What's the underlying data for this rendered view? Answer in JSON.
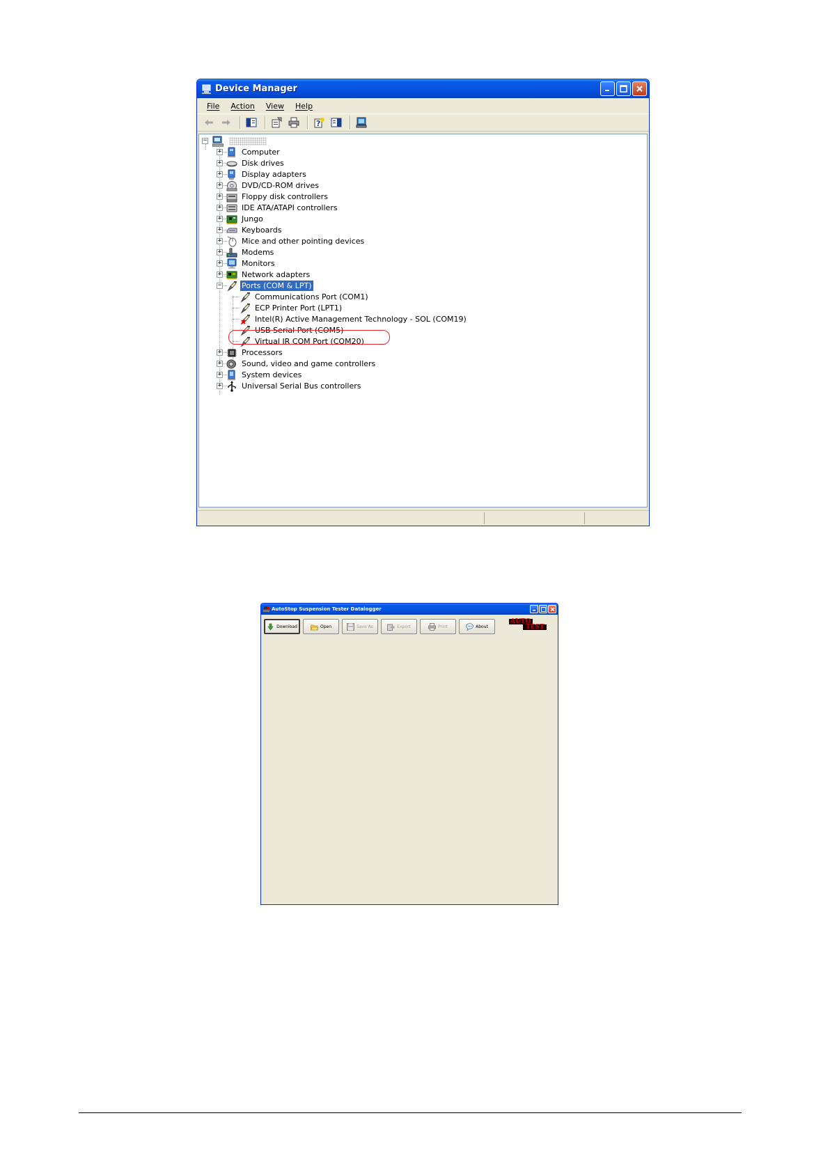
{
  "device_manager": {
    "title": "Device Manager",
    "menu": [
      "File",
      "Action",
      "View",
      "Help"
    ],
    "toolbar_icons": [
      "back-arrow-icon",
      "forward-arrow-icon",
      "show-hide-tree-icon",
      "properties-icon",
      "print-icon",
      "help-icon",
      "show-hide-console-icon",
      "scan-hardware-icon"
    ],
    "tree": {
      "root_label": "",
      "categories": [
        {
          "label": "Computer",
          "icon": "computer-icon",
          "expanded": false
        },
        {
          "label": "Disk drives",
          "icon": "disk-drive-icon",
          "expanded": false
        },
        {
          "label": "Display adapters",
          "icon": "display-adapter-icon",
          "expanded": false
        },
        {
          "label": "DVD/CD-ROM drives",
          "icon": "cd-drive-icon",
          "expanded": false
        },
        {
          "label": "Floppy disk controllers",
          "icon": "floppy-controller-icon",
          "expanded": false
        },
        {
          "label": "IDE ATA/ATAPI controllers",
          "icon": "ide-controller-icon",
          "expanded": false
        },
        {
          "label": "Jungo",
          "icon": "board-icon",
          "expanded": false
        },
        {
          "label": "Keyboards",
          "icon": "keyboard-icon",
          "expanded": false
        },
        {
          "label": "Mice and other pointing devices",
          "icon": "mouse-icon",
          "expanded": false
        },
        {
          "label": "Modems",
          "icon": "modem-icon",
          "expanded": false
        },
        {
          "label": "Monitors",
          "icon": "monitor-icon",
          "expanded": false
        },
        {
          "label": "Network adapters",
          "icon": "network-adapter-icon",
          "expanded": false
        },
        {
          "label": "Ports (COM & LPT)",
          "icon": "port-icon",
          "expanded": true,
          "selected": true,
          "children": [
            {
              "label": "Communications Port (COM1)",
              "icon": "port-icon"
            },
            {
              "label": "ECP Printer Port (LPT1)",
              "icon": "port-icon"
            },
            {
              "label": "Intel(R) Active Management Technology - SOL (COM19)",
              "icon": "port-icon"
            },
            {
              "label": "USB Serial Port (COM5)",
              "icon": "port-icon",
              "highlighted": true
            },
            {
              "label": "Virtual IR COM Port (COM20)",
              "icon": "port-icon"
            }
          ]
        },
        {
          "label": "Processors",
          "icon": "processor-icon",
          "expanded": false
        },
        {
          "label": "Sound, video and game controllers",
          "icon": "sound-icon",
          "expanded": false
        },
        {
          "label": "System devices",
          "icon": "system-device-icon",
          "expanded": false
        },
        {
          "label": "Universal Serial Bus controllers",
          "icon": "usb-icon",
          "expanded": false
        }
      ]
    }
  },
  "datalogger": {
    "title": "AutoStop Suspension Tester Datalogger",
    "buttons": [
      {
        "label": "Download",
        "icon": "download-arrow-icon",
        "enabled": true,
        "default": true
      },
      {
        "label": "Open",
        "icon": "folder-open-icon",
        "enabled": true
      },
      {
        "label": "Save As",
        "icon": "floppy-save-icon",
        "enabled": false
      },
      {
        "label": "Export",
        "icon": "export-icon",
        "enabled": false
      },
      {
        "label": "Print",
        "icon": "printer-icon",
        "enabled": false
      },
      {
        "label": "About",
        "icon": "speech-bubble-icon",
        "enabled": true
      }
    ],
    "logo": {
      "line1": "AUTO",
      "line2": "TEST"
    }
  },
  "colors": {
    "xp_blue": "#0655e0",
    "selection": "#316ac5",
    "highlight_ring": "#e8262a",
    "window_face": "#ece9d8"
  }
}
